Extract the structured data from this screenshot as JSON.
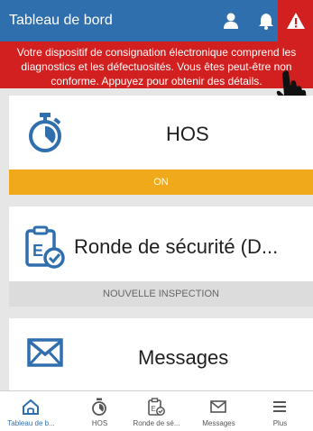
{
  "header": {
    "title": "Tableau de bord",
    "icons": [
      "user-icon",
      "bell-icon",
      "warning-icon"
    ]
  },
  "banner": {
    "line1": "Votre dispositif de consignation électronique comprend les",
    "line2": "diagnostics et les défectuosités. Vous êtes peut-être non",
    "line3": "conforme. Appuyez pour obtenir des détails."
  },
  "cards": {
    "hos": {
      "label": "HOS",
      "status": "ON",
      "status_color": "#f0a91a"
    },
    "safety": {
      "label": "Ronde de sécurité (D...",
      "action": "NOUVELLE INSPECTION"
    },
    "messages": {
      "label": "Messages"
    }
  },
  "tabbar": {
    "items": [
      {
        "label": "Tableau de b...",
        "icon": "home-icon",
        "active": true
      },
      {
        "label": "HOS",
        "icon": "stopwatch-icon"
      },
      {
        "label": "Ronde de sé...",
        "icon": "clipboard-check-icon"
      },
      {
        "label": "Messages",
        "icon": "envelope-icon"
      },
      {
        "label": "Plus",
        "icon": "menu-icon"
      }
    ]
  },
  "colors": {
    "brand_blue": "#2f6fae",
    "alert_red": "#d21f1f",
    "hos_on": "#f0a91a",
    "action_gray": "#dcdcdc"
  }
}
